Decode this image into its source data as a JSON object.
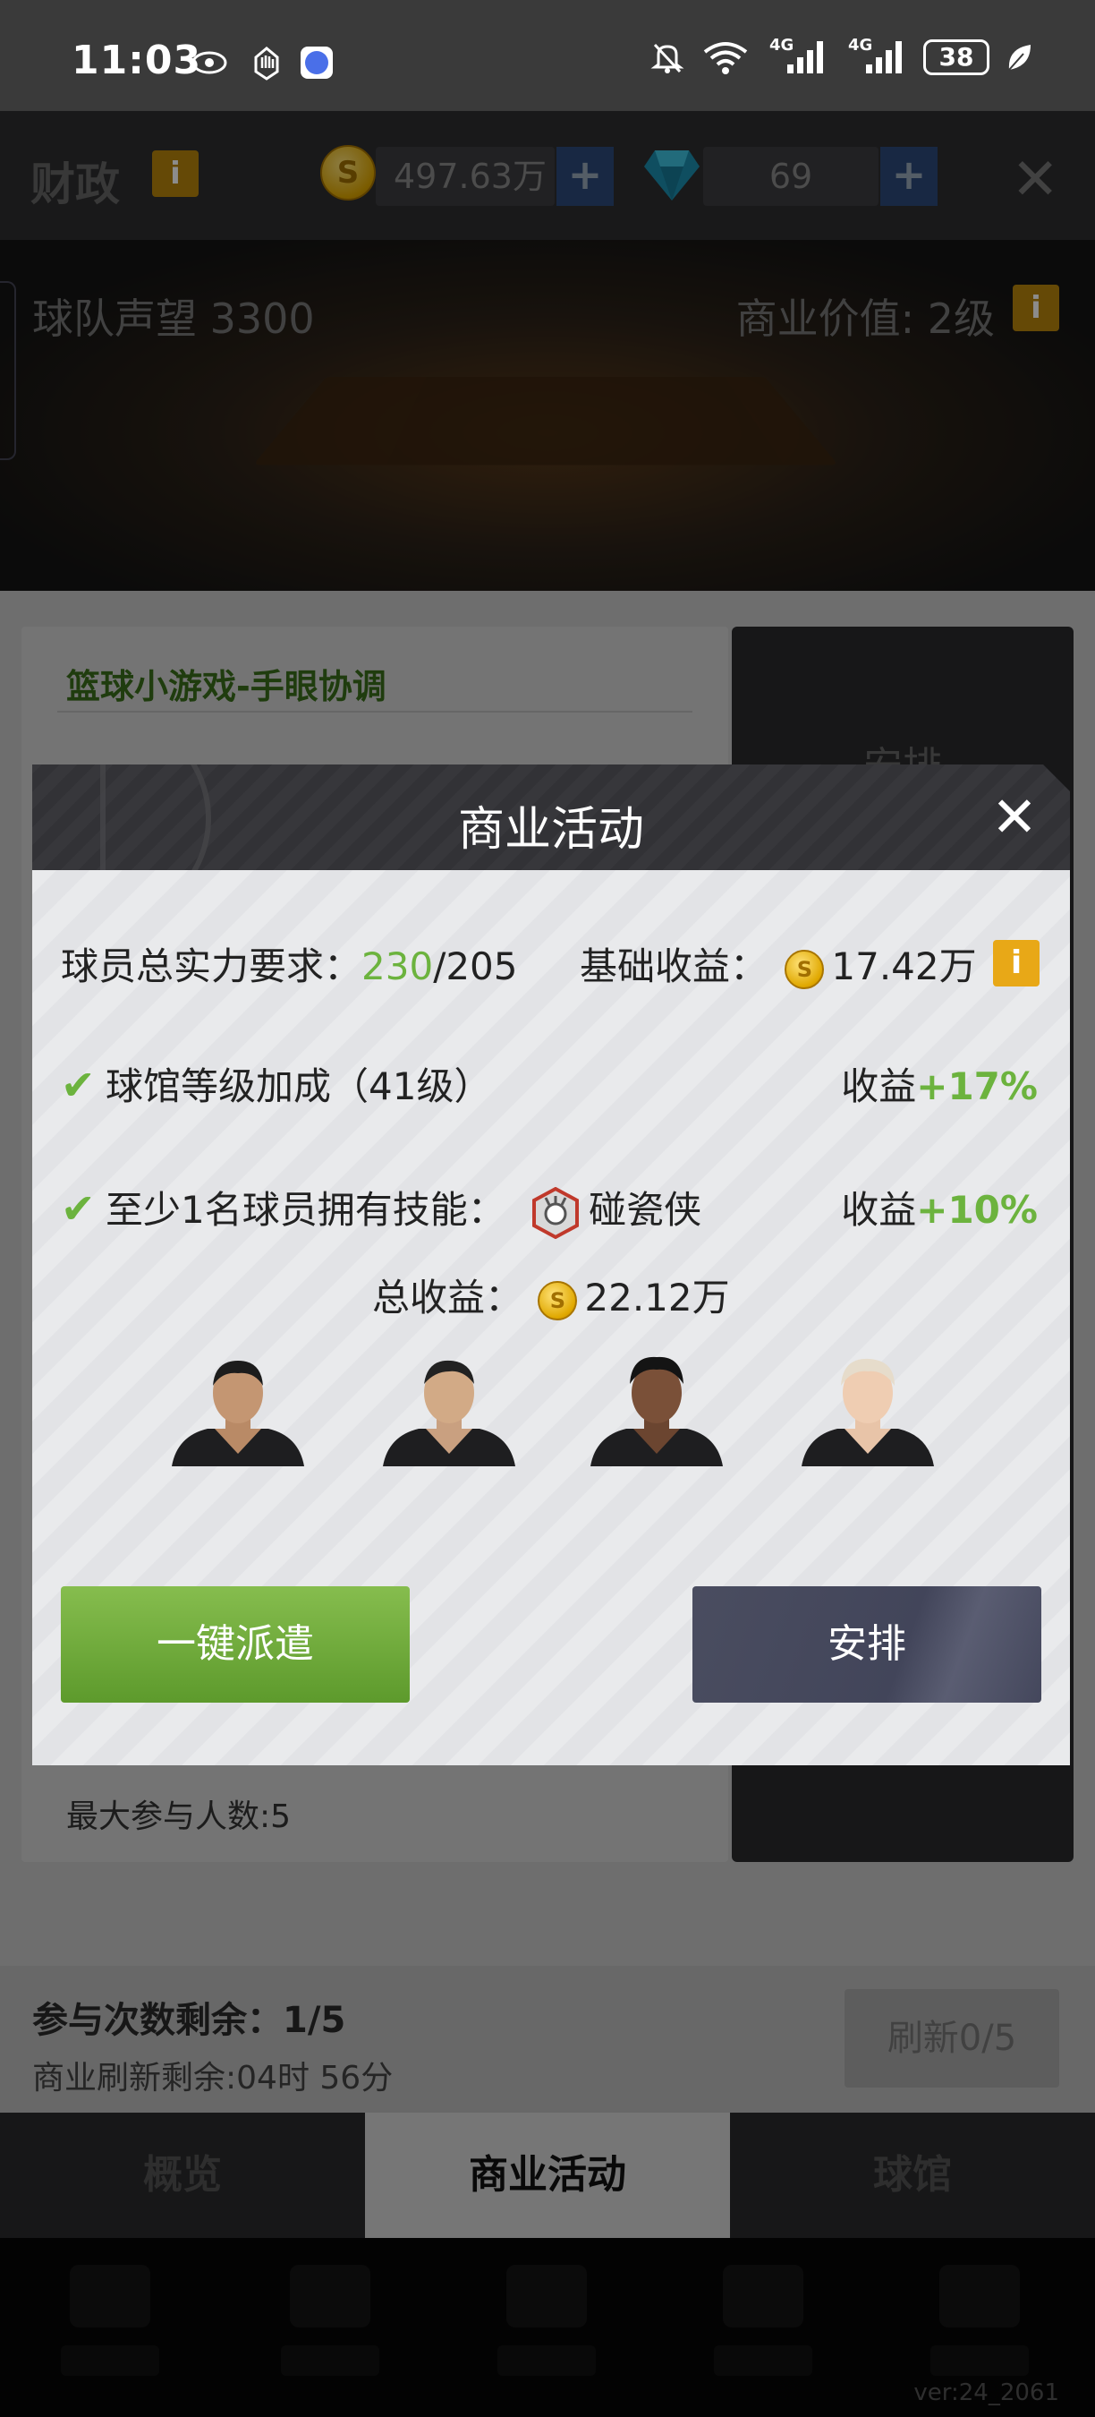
{
  "status_bar": {
    "time": "11:03",
    "net1": "4G",
    "net2": "4G",
    "battery": "38"
  },
  "header": {
    "title": "财政",
    "info_symbol": "i",
    "coin_symbol": "S",
    "coins": "497.63万",
    "gems": "69",
    "plus": "+",
    "close": "✕"
  },
  "banner": {
    "reputation": "球队声望 3300",
    "business_value": "商业价值: 2级"
  },
  "background_card": {
    "game_title": "篮球小游戏-手眼协调",
    "max_participants": "最大参与人数:5",
    "arrange_label": "安排"
  },
  "bottom": {
    "remaining": "参与次数剩余：1/5",
    "refresh_time": "商业刷新剩余:04时 56分",
    "refresh_button": "刷新0/5"
  },
  "tabs": [
    {
      "label": "概览"
    },
    {
      "label": "商业活动"
    },
    {
      "label": "球馆"
    }
  ],
  "version": "ver:24_2061",
  "dialog": {
    "title": "商业活动",
    "close": "✕",
    "power_label": "球员总实力要求：",
    "power_current": "230",
    "power_required": "/205",
    "base_income_label": "基础收益：",
    "base_income": "17.42万",
    "bonus1_label": "球馆等级加成（41级）",
    "bonus1_income_label": "收益",
    "bonus1_value": "+17%",
    "bonus2_label": "至少1名球员拥有技能：",
    "bonus2_skill": "碰瓷侠",
    "bonus2_income_label": "收益",
    "bonus2_value": "+10%",
    "total_label": "总收益：",
    "total_value": "22.12万",
    "dispatch_button": "一键派遣",
    "arrange_button": "安排"
  },
  "colors": {
    "accent_green": "#6cb33e",
    "info_orange": "#e8a817",
    "dialog_header": "#37373b",
    "button_dark": "#4a4d60"
  }
}
